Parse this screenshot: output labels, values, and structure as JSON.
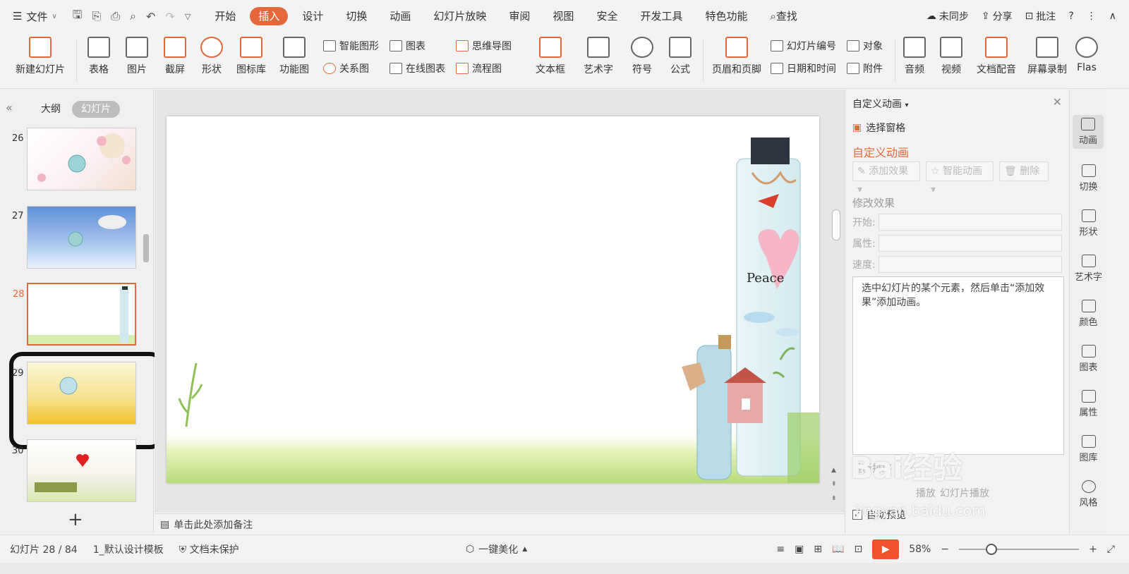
{
  "topbar": {
    "file_label": "文件",
    "tabs": [
      "开始",
      "插入",
      "设计",
      "切换",
      "动画",
      "幻灯片放映",
      "审阅",
      "视图",
      "安全",
      "开发工具",
      "特色功能"
    ],
    "active_tab": "插入",
    "search": "查找",
    "right": {
      "sync": "未同步",
      "share": "分享",
      "review": "批注"
    }
  },
  "ribbon": {
    "new_slide": "新建幻灯片",
    "table": "表格",
    "image": "图片",
    "screenshot": "截屏",
    "shape": "形状",
    "iconlib": "图标库",
    "funcchart": "功能图",
    "smartart": "智能图形",
    "chart": "图表",
    "relation": "关系图",
    "onlinechart": "在线图表",
    "mindmap": "思维导图",
    "flowchart": "流程图",
    "textbox": "文本框",
    "wordart": "艺术字",
    "symbol": "符号",
    "formula": "公式",
    "headerfooter": "页眉和页脚",
    "slidenum": "幻灯片编号",
    "object": "对象",
    "datetime": "日期和时间",
    "attachment": "附件",
    "audio": "音频",
    "video": "视频",
    "dubbing": "文档配音",
    "screenrec": "屏幕录制",
    "flash": "Flas"
  },
  "leftpanel": {
    "outline_tab": "大纲",
    "slides_tab": "幻灯片",
    "thumbs": [
      {
        "num": "26"
      },
      {
        "num": "27"
      },
      {
        "num": "28"
      },
      {
        "num": "29"
      },
      {
        "num": "30"
      }
    ]
  },
  "notes": {
    "placeholder": "单击此处添加备注"
  },
  "rightpanel": {
    "title": "自定义动画",
    "select_pane": "选择窗格",
    "subtitle": "自定义动画",
    "add_effect": "添加效果",
    "smart_anim": "智能动画",
    "delete": "删除",
    "modify_section": "修改效果",
    "start_label": "开始:",
    "property_label": "属性:",
    "speed_label": "速度:",
    "message": "选中幻灯片的某个元素，然后单击“添加效果”添加动画。",
    "reorder": "重新排序",
    "play": "播放",
    "slideshow": "幻灯片播放",
    "autopreview": "自动预览"
  },
  "sidebar": {
    "items": [
      "动画",
      "切换",
      "形状",
      "艺术字",
      "颜色",
      "图表",
      "属性",
      "图库",
      "风格"
    ]
  },
  "statusbar": {
    "slide_info": "幻灯片 28 / 84",
    "template": "1_默认设计模板",
    "protect": "文档未保护",
    "beautify": "一键美化",
    "zoom": "58%"
  },
  "watermark": {
    "brand": "Bai经验",
    "url": "jingyan.baidu.com"
  },
  "colors": {
    "accent": "#e5683a",
    "play": "#f0522c"
  }
}
